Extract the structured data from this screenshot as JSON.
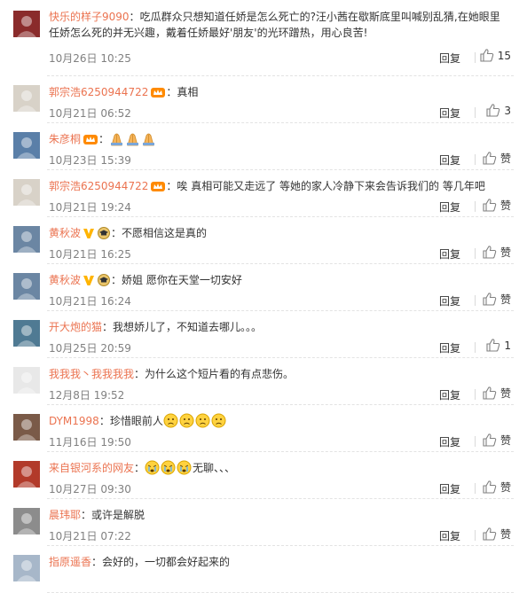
{
  "comments": [
    {
      "user": "快乐的样子9090",
      "badges": [],
      "text": "吃瓜群众只想知道任娇是怎么死亡的?汪小茜在歇斯底里叫喊别乱猜,在她眼里任娇怎么死的并无兴趣，戴着任娇最好'朋友'的光环蹭热，用心良苦!",
      "time": "10月26日 10:25",
      "reply": "回复",
      "like": "15",
      "avatar_color": "#8a2b2b"
    },
    {
      "user": "郭宗浩6250944722",
      "badges": [
        "crown"
      ],
      "text": "真相",
      "time": "10月21日 06:52",
      "reply": "回复",
      "like": "3",
      "avatar_color": "#d8d2c8"
    },
    {
      "user": "朱彦桐",
      "badges": [
        "crown"
      ],
      "text": "",
      "emojis": [
        "pray",
        "pray",
        "pray"
      ],
      "time": "10月23日 15:39",
      "reply": "回复",
      "like": "赞",
      "avatar_color": "#5a7fa8"
    },
    {
      "user": "郭宗浩6250944722",
      "badges": [
        "crown"
      ],
      "text": "唉  真相可能又走远了  等她的家人冷静下来会告诉我们的  等几年吧",
      "time": "10月21日 19:24",
      "reply": "回复",
      "like": "赞",
      "avatar_color": "#d8d2c8"
    },
    {
      "user": "黄秋波",
      "badges": [
        "v",
        "grad"
      ],
      "text": "不愿相信这是真的",
      "time": "10月21日 16:25",
      "reply": "回复",
      "like": "赞",
      "avatar_color": "#6b86a3"
    },
    {
      "user": "黄秋波",
      "badges": [
        "v",
        "grad"
      ],
      "text": "娇姐 愿你在天堂一切安好",
      "time": "10月21日 16:24",
      "reply": "回复",
      "like": "赞",
      "avatar_color": "#6b86a3"
    },
    {
      "user": "开大炮的猫",
      "badges": [],
      "text": "我想娇儿了，不知道去哪儿。。。",
      "time": "10月25日 20:59",
      "reply": "回复",
      "like": "1",
      "avatar_color": "#4f7a93"
    },
    {
      "user": "我我我丶我我我我",
      "badges": [],
      "text": "为什么这个短片看的有点悲伤。",
      "time": "12月8日 19:52",
      "reply": "回复",
      "like": "赞",
      "avatar_color": "#e8e8e8"
    },
    {
      "user": "DYM1998",
      "badges": [],
      "text": "珍惜眼前人",
      "emojis": [
        "sad",
        "sad",
        "sad",
        "sad"
      ],
      "time": "11月16日 19:50",
      "reply": "回复",
      "like": "赞",
      "avatar_color": "#7a5a48"
    },
    {
      "user": "来自银河系的网友",
      "badges": [],
      "text": "",
      "emojis": [
        "cry",
        "cry",
        "cry"
      ],
      "after": "无聊、、、",
      "time": "10月27日 09:30",
      "reply": "回复",
      "like": "赞",
      "avatar_color": "#b23a2a"
    },
    {
      "user": "晨玮耶",
      "badges": [],
      "text": "或许是解脱",
      "time": "10月21日 07:22",
      "reply": "回复",
      "like": "赞",
      "avatar_color": "#8c8c8c"
    },
    {
      "user": "指原遥香",
      "badges": [],
      "text": "会好的，一切都会好起来的",
      "time": "",
      "reply": "",
      "like": "",
      "avatar_color": "#a7b7c9"
    }
  ]
}
